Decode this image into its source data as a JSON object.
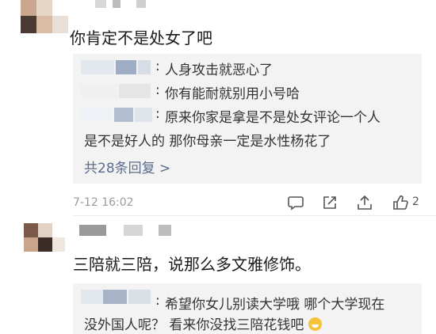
{
  "comment1": {
    "text": "你肯定不是处女了吧",
    "replies": [
      {
        "text": "人身攻击就恶心了"
      },
      {
        "text": "你有能耐就别用小号哈"
      },
      {
        "text": "原来你家是拿是不是处女评论一个人"
      },
      {
        "text": "是不是好人的 那你母亲一定是水性杨花了"
      }
    ],
    "more_replies": "共28条回复 >",
    "timestamp": "7-12 16:02",
    "like_count": "2",
    "colon": ":",
    "icons": [
      "comment-icon",
      "share-icon",
      "like-icon"
    ]
  },
  "comment2": {
    "text": "三陪就三陪，说那么多文雅修饰。",
    "replies": [
      {
        "text": "希望你女儿别读大学哦 哪个大学现在"
      },
      {
        "text": "没外国人呢？ 看来你没找三陪花钱吧"
      }
    ],
    "colon": ":",
    "emoji": "grinning-face-emoji"
  },
  "colors": {
    "link": "#5b6b8c",
    "reply_bg": "#f3f3f3",
    "timestamp": "#9b9b9b"
  }
}
